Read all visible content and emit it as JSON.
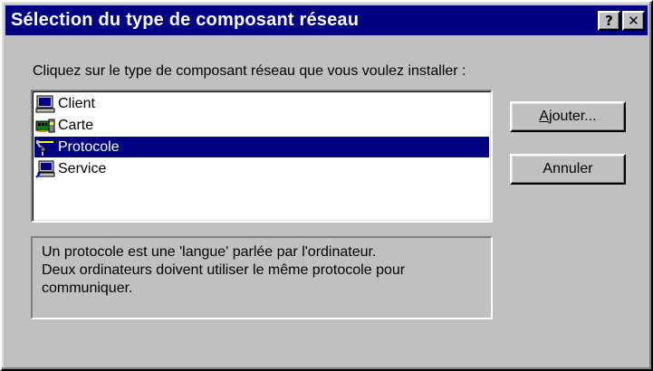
{
  "window": {
    "title": "Sélection du type de composant réseau",
    "help_button": "?",
    "close_button": "✕"
  },
  "instruction": "Cliquez sur le type de composant réseau que vous voulez installer :",
  "components": [
    {
      "label": "Client",
      "icon": "client-computer-icon",
      "selected": false
    },
    {
      "label": "Carte",
      "icon": "network-card-icon",
      "selected": false
    },
    {
      "label": "Protocole",
      "icon": "protocol-cable-icon",
      "selected": true
    },
    {
      "label": "Service",
      "icon": "service-computer-icon",
      "selected": false
    }
  ],
  "buttons": {
    "add_prefix": "A",
    "add_rest": "jouter...",
    "cancel": "Annuler"
  },
  "description": {
    "line1": "Un protocole est une 'langue' parlée par l'ordinateur.",
    "line2": "Deux ordinateurs doivent utiliser le même protocole pour",
    "line3": "communiquer."
  },
  "colors": {
    "title_bar": "#000080",
    "selection": "#000080",
    "face": "#c0c0c0"
  }
}
